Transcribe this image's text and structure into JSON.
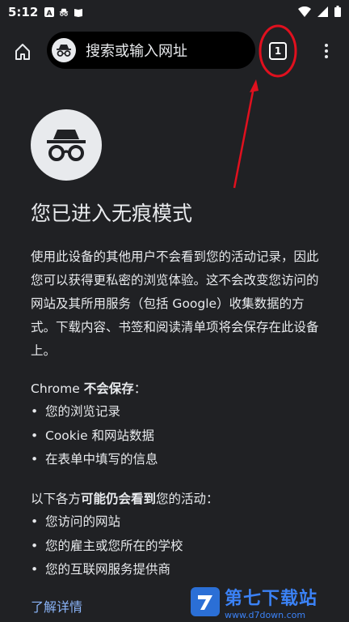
{
  "status_bar": {
    "time": "5:12"
  },
  "toolbar": {
    "omnibox_placeholder": "搜索或输入网址",
    "tab_count": "1"
  },
  "page": {
    "title": "您已进入无痕模式",
    "description": "使用此设备的其他用户不会看到您的活动记录，因此您可以获得更私密的浏览体验。这不会改变您访问的网站及其所用服务（包括 Google）收集数据的方式。下载内容、书签和阅读清单项将会保存在此设备上。",
    "not_saved": {
      "prefix": "Chrome ",
      "bold": "不会保存",
      "suffix": "：",
      "items": [
        "您的浏览记录",
        "Cookie 和网站数据",
        "在表单中填写的信息"
      ]
    },
    "visible_to": {
      "prefix": "以下各方",
      "bold": "可能仍会看到",
      "suffix": "您的活动：",
      "items": [
        "您访问的网站",
        "您的雇主或您所在的学校",
        "您的互联网服务提供商"
      ]
    },
    "learn_more": "了解详情"
  },
  "watermark": {
    "title": "第七下载站",
    "url": "www.d7down.com"
  },
  "colors": {
    "background": "#202124",
    "text": "#e8eaed",
    "link": "#8ab4f8",
    "annotation": "#e0101e"
  }
}
